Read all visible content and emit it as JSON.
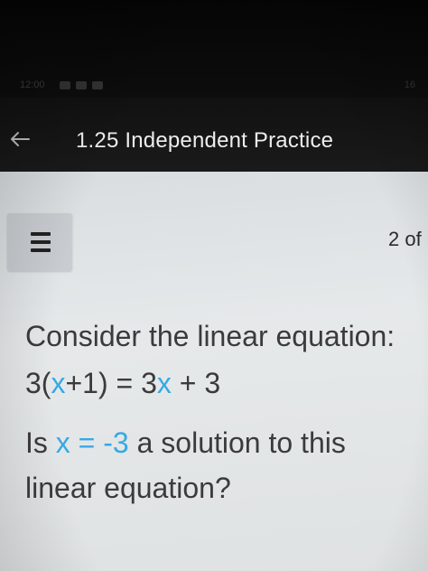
{
  "status_bar": {
    "time": "12:00",
    "right_text": "16"
  },
  "app_bar": {
    "back_icon": "arrow-left-icon",
    "title": "1.25 Independent Practice"
  },
  "toolbar": {
    "menu_icon": "hamburger-menu-icon",
    "page_counter": "2 of"
  },
  "question": {
    "prompt": "Consider the linear equation:",
    "equation": {
      "part1": "3(",
      "var1": "x",
      "part2": "+1) = 3",
      "var2": "x",
      "part3": " + 3"
    },
    "ask": {
      "part1": "Is ",
      "var_expr": "x = -3",
      "part2": " a solution to this",
      "line2": "linear equation?"
    }
  },
  "colors": {
    "variable": "#35a9e4",
    "text": "#3b3b3b",
    "app_bar_bg": "#151515",
    "content_bg": "#e3e6e7"
  }
}
